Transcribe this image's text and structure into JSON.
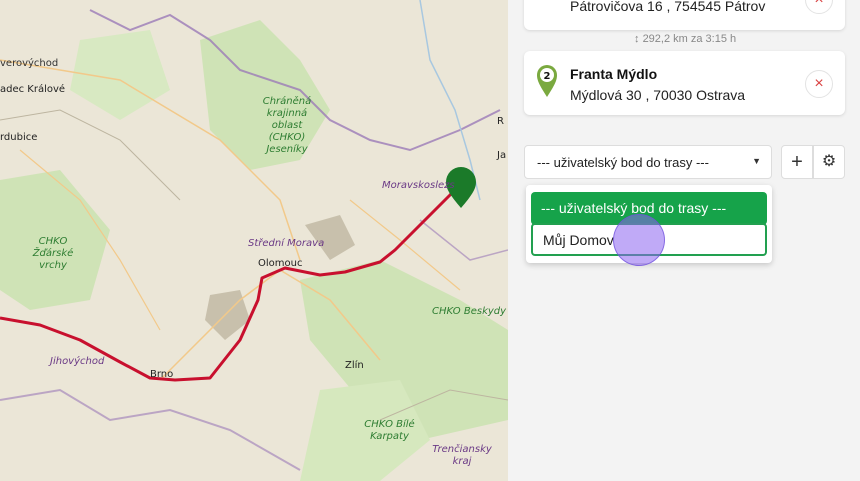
{
  "map": {
    "labels": {
      "vychod": "verovýchod",
      "hradec": "adec Králové",
      "pardubice": "rdubice",
      "chko_jeseniky": "Chráněná krajinná oblast (CHKO) Jeseníky",
      "moravskoslezsky": "Moravskoslezs",
      "zdarske": "CHKO Žďárské vrchy",
      "stredni_morava": "Střední Morava",
      "olomouc": "Olomouc",
      "beskydy": "CHKO Beskydy",
      "jihovychod": "Jihovýchod",
      "brno": "Brno",
      "zlin": "Zlín",
      "bile_karpaty": "CHKO Bílé Karpaty",
      "trenciansky": "Trenčiansky kraj",
      "r": "R",
      "ja": "Ja"
    },
    "colors": {
      "route": "#c8102e",
      "marker": "#1b8a2b"
    }
  },
  "route": {
    "stops": [
      {
        "number": "",
        "name": "",
        "address": "Pátrovičova 16 , 754545 Pátrov"
      },
      {
        "number": "2",
        "name": "Franta Mýdlo",
        "address": "Mýdlová 30 , 70030 Ostrava"
      }
    ],
    "distance": "292,2 km za 3:15 h"
  },
  "add_point": {
    "select_value": "--- uživatelský bod do trasy ---",
    "options": [
      "--- uživatelský bod do trasy ---",
      "Můj Domov"
    ],
    "plus_icon": "plus-icon",
    "settings_icon": "gear-icon"
  },
  "accent": "#16a34a"
}
